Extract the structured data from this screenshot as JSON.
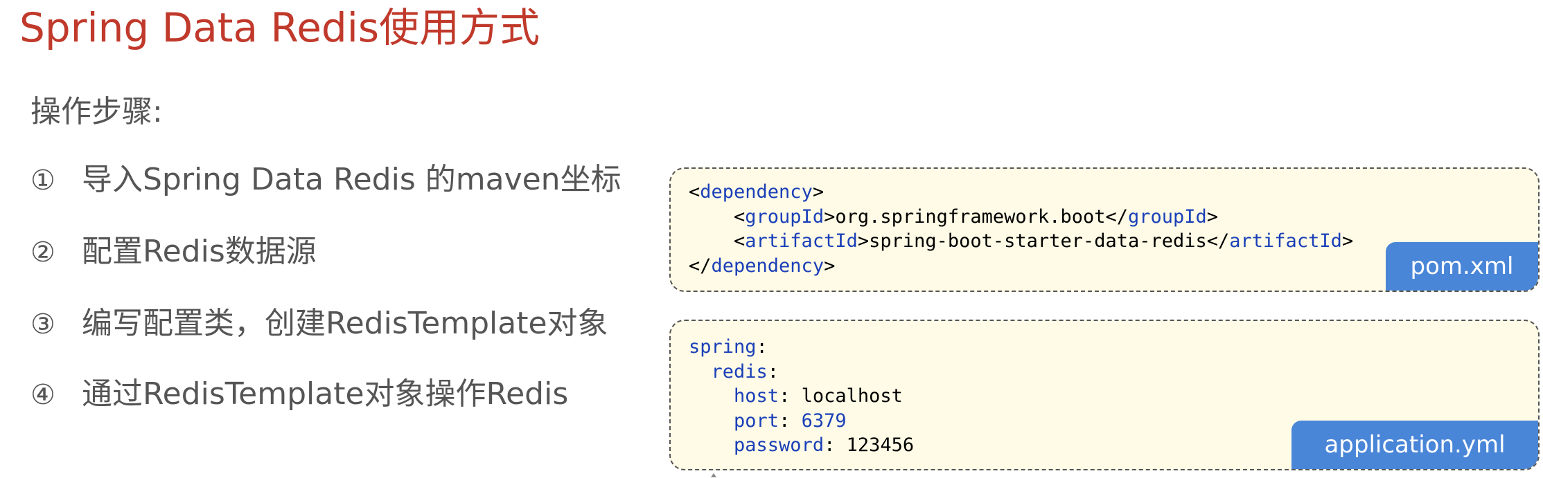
{
  "slide": {
    "title": "Spring Data Redis使用方式",
    "subhead": "操作步骤:",
    "steps": [
      {
        "num": "①",
        "text": "导入Spring Data Redis 的maven坐标"
      },
      {
        "num": "②",
        "text": "配置Redis数据源"
      },
      {
        "num": "③",
        "text": "编写配置类，创建RedisTemplate对象"
      },
      {
        "num": "④",
        "text": "通过RedisTemplate对象操作Redis"
      }
    ]
  },
  "pom": {
    "file_label": "pom.xml",
    "lines": [
      [
        {
          "t": "<",
          "c": "plain"
        },
        {
          "t": "dependency",
          "c": "kw"
        },
        {
          "t": ">",
          "c": "plain"
        }
      ],
      [
        {
          "t": "    <",
          "c": "plain"
        },
        {
          "t": "groupId",
          "c": "kw"
        },
        {
          "t": ">org.springframework.boot</",
          "c": "plain"
        },
        {
          "t": "groupId",
          "c": "kw"
        },
        {
          "t": ">",
          "c": "plain"
        }
      ],
      [
        {
          "t": "    <",
          "c": "plain"
        },
        {
          "t": "artifactId",
          "c": "kw"
        },
        {
          "t": ">spring-boot-starter-data-redis</",
          "c": "plain"
        },
        {
          "t": "artifactId",
          "c": "kw"
        },
        {
          "t": ">",
          "c": "plain"
        }
      ],
      [
        {
          "t": "</",
          "c": "plain"
        },
        {
          "t": "dependency",
          "c": "kw"
        },
        {
          "t": ">",
          "c": "plain"
        }
      ]
    ]
  },
  "yml": {
    "file_label": "application.yml",
    "lines": [
      [
        {
          "t": "spring",
          "c": "kw"
        },
        {
          "t": ":",
          "c": "plain"
        }
      ],
      [
        {
          "t": "  ",
          "c": "plain"
        },
        {
          "t": "redis",
          "c": "kw"
        },
        {
          "t": ":",
          "c": "plain"
        }
      ],
      [
        {
          "t": "    ",
          "c": "plain"
        },
        {
          "t": "host",
          "c": "kw"
        },
        {
          "t": ": localhost",
          "c": "plain"
        }
      ],
      [
        {
          "t": "    ",
          "c": "plain"
        },
        {
          "t": "port",
          "c": "kw"
        },
        {
          "t": ": ",
          "c": "plain"
        },
        {
          "t": "6379",
          "c": "num-val"
        }
      ],
      [
        {
          "t": "    ",
          "c": "plain"
        },
        {
          "t": "password",
          "c": "kw"
        },
        {
          "t": ": 123456",
          "c": "plain"
        }
      ]
    ]
  },
  "colors": {
    "title": "#c0392b",
    "body_text": "#555555",
    "code_keyword": "#1a3fb8",
    "code_box_bg": "#fffbe6",
    "file_tag_bg": "#4a86d8"
  }
}
